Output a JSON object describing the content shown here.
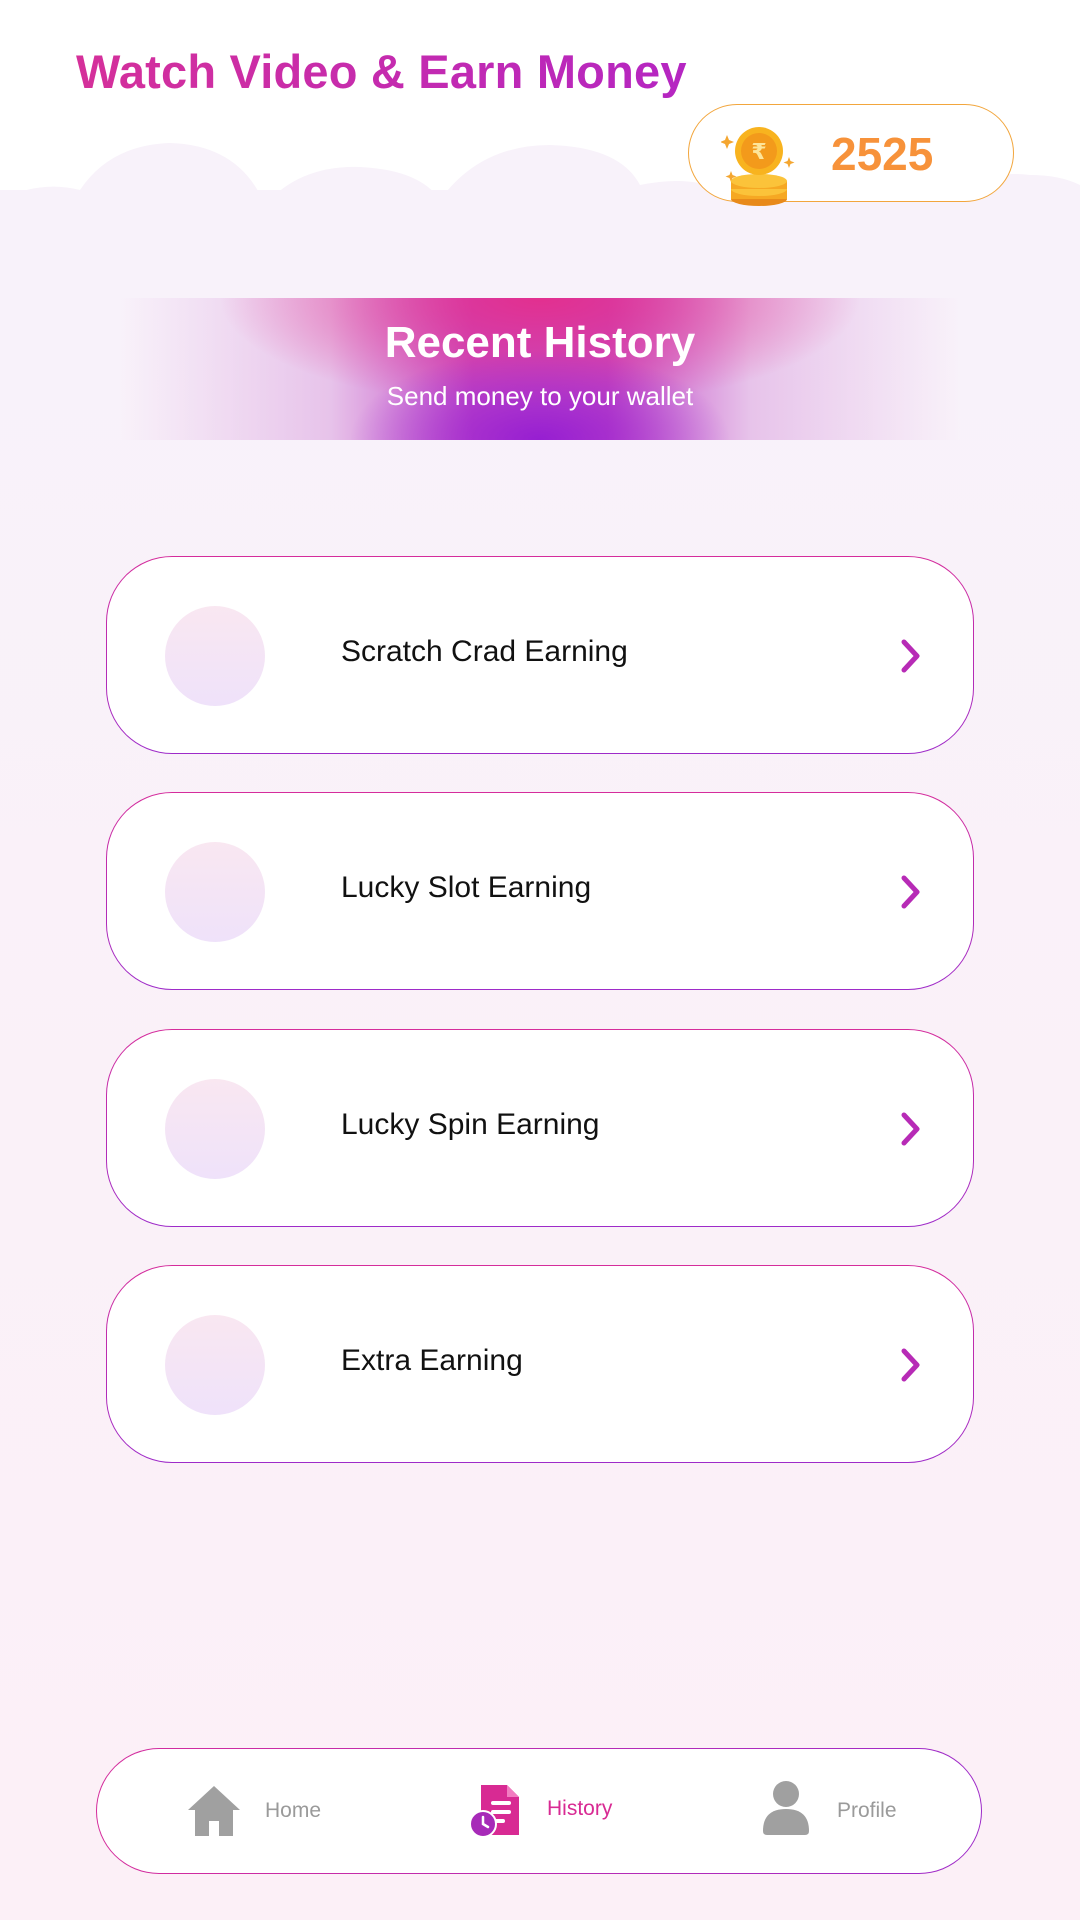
{
  "header": {
    "title": "Watch Video & Earn Money"
  },
  "wallet": {
    "coins": "2525",
    "icon": "rupee-coin-stack-icon"
  },
  "banner": {
    "title": "Recent History",
    "subtitle": "Send money to your wallet"
  },
  "history_items": [
    {
      "label": "Scratch Crad Earning"
    },
    {
      "label": "Lucky Slot Earning"
    },
    {
      "label": "Lucky Spin Earning"
    },
    {
      "label": "Extra Earning"
    }
  ],
  "nav": {
    "items": [
      {
        "label": "Home",
        "icon": "home-icon",
        "active": false
      },
      {
        "label": "History",
        "icon": "history-icon",
        "active": true
      },
      {
        "label": "Profile",
        "icon": "profile-icon",
        "active": false
      }
    ]
  },
  "colors": {
    "accent_pink": "#d82a93",
    "accent_purple": "#9e2bc9",
    "coin_orange": "#f7923a",
    "nav_inactive": "#9a9a9a"
  }
}
